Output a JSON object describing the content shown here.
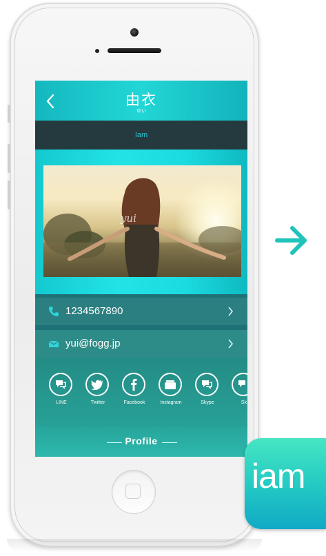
{
  "navbar": {
    "title": "由衣",
    "subtitle": "ゆい"
  },
  "subbar": {
    "text": "Iam"
  },
  "photo": {
    "signature": "yui"
  },
  "contacts": {
    "phone": "1234567890",
    "email": "yui@fogg.jp"
  },
  "social": [
    {
      "label": "LINE",
      "icon": "line-icon"
    },
    {
      "label": "Twitter",
      "icon": "twitter-icon"
    },
    {
      "label": "Facebook",
      "icon": "facebook-icon"
    },
    {
      "label": "Instagram",
      "icon": "instagram-icon"
    },
    {
      "label": "Skype",
      "icon": "skype-icon"
    },
    {
      "label": "Sk",
      "icon": "skype-icon"
    }
  ],
  "profile": {
    "heading": "Profile"
  },
  "app_icon": {
    "text": "iam"
  },
  "colors": {
    "accent": "#22d6d6",
    "dark_bar": "#253a3f",
    "teal": "#2b7f80",
    "app_icon_top": "#46e6c3"
  }
}
